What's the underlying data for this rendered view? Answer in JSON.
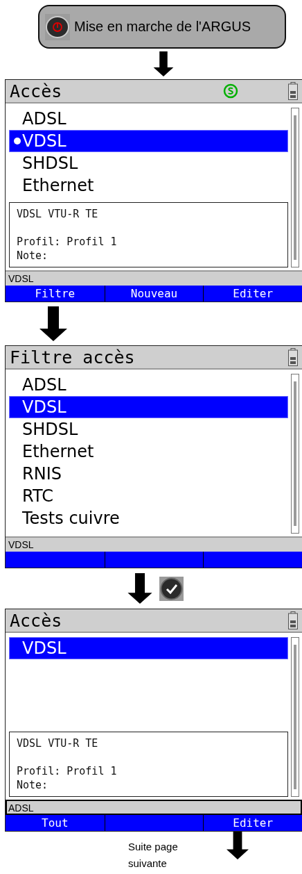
{
  "callout": {
    "text": "Mise en marche de l'ARGUS"
  },
  "screens": [
    {
      "title": "Accès",
      "s_indicator": true,
      "items": [
        {
          "label": "ADSL",
          "selected": false,
          "active": false
        },
        {
          "label": "VDSL",
          "selected": true,
          "active": true
        },
        {
          "label": "SHDSL",
          "selected": false,
          "active": false
        },
        {
          "label": "Ethernet",
          "selected": false,
          "active": false
        }
      ],
      "info": {
        "name": "VDSL VTU-R TE",
        "profile": "Profil: Profil 1",
        "note": "Note:"
      },
      "status": {
        "text": "VDSL",
        "focused": false
      },
      "softkeys": {
        "left": "Filtre",
        "middle": "Nouveau",
        "right": "Editer"
      }
    },
    {
      "title": "Filtre accès",
      "s_indicator": false,
      "items": [
        {
          "label": "ADSL",
          "selected": false,
          "active": false
        },
        {
          "label": "VDSL",
          "selected": true,
          "active": false
        },
        {
          "label": "SHDSL",
          "selected": false,
          "active": false
        },
        {
          "label": "Ethernet",
          "selected": false,
          "active": false
        },
        {
          "label": "RNIS",
          "selected": false,
          "active": false
        },
        {
          "label": "RTC",
          "selected": false,
          "active": false
        },
        {
          "label": "Tests cuivre",
          "selected": false,
          "active": false
        }
      ],
      "status": {
        "text": "VDSL",
        "focused": false
      }
    },
    {
      "title": "Accès",
      "s_indicator": false,
      "items": [
        {
          "label": "VDSL",
          "selected": true,
          "active": false
        }
      ],
      "info": {
        "name": "VDSL VTU-R TE",
        "profile": "Profil: Profil 1",
        "note": "Note:"
      },
      "status": {
        "text": "ADSL",
        "focused": true
      },
      "softkeys": {
        "left": "Tout",
        "right": "Editer"
      }
    }
  ],
  "footer": {
    "text": "Suite page suivante"
  }
}
